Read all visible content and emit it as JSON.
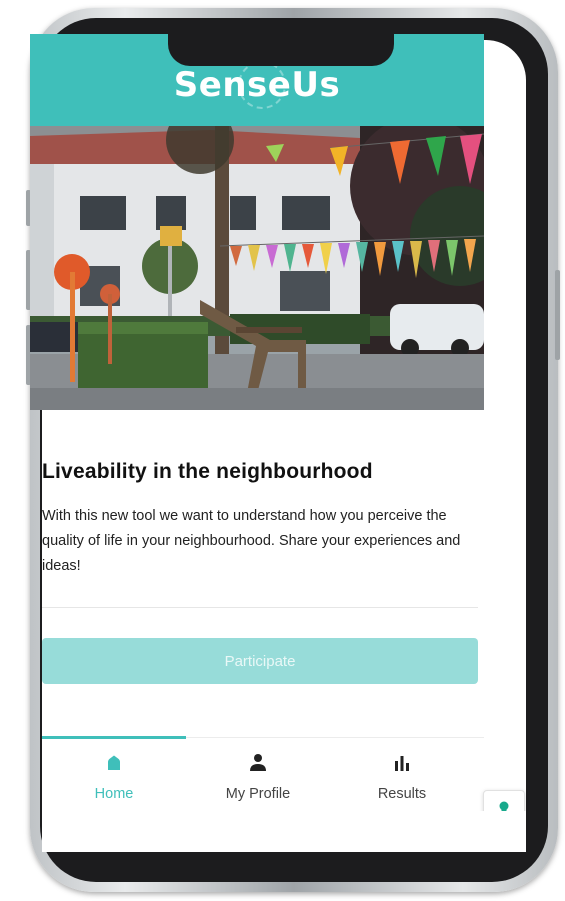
{
  "app": {
    "brand": "SenseUs",
    "brand_color": "#3fbfba"
  },
  "hero": {
    "image_icon": "neighbourhood-street-photo"
  },
  "content": {
    "title": "Liveability in the neighbourhood",
    "description": "With this new tool we want to understand how you perceive the quality of life in your neighbourhood. Share your experiences and ideas!",
    "participate_label": "Participate"
  },
  "tabs": [
    {
      "label": "Home",
      "icon": "home-icon",
      "active": true
    },
    {
      "label": "My Profile",
      "icon": "person-icon",
      "active": false
    },
    {
      "label": "Results",
      "icon": "bar-chart-icon",
      "active": false
    }
  ],
  "floating_button": {
    "icon": "keyhole-icon"
  }
}
